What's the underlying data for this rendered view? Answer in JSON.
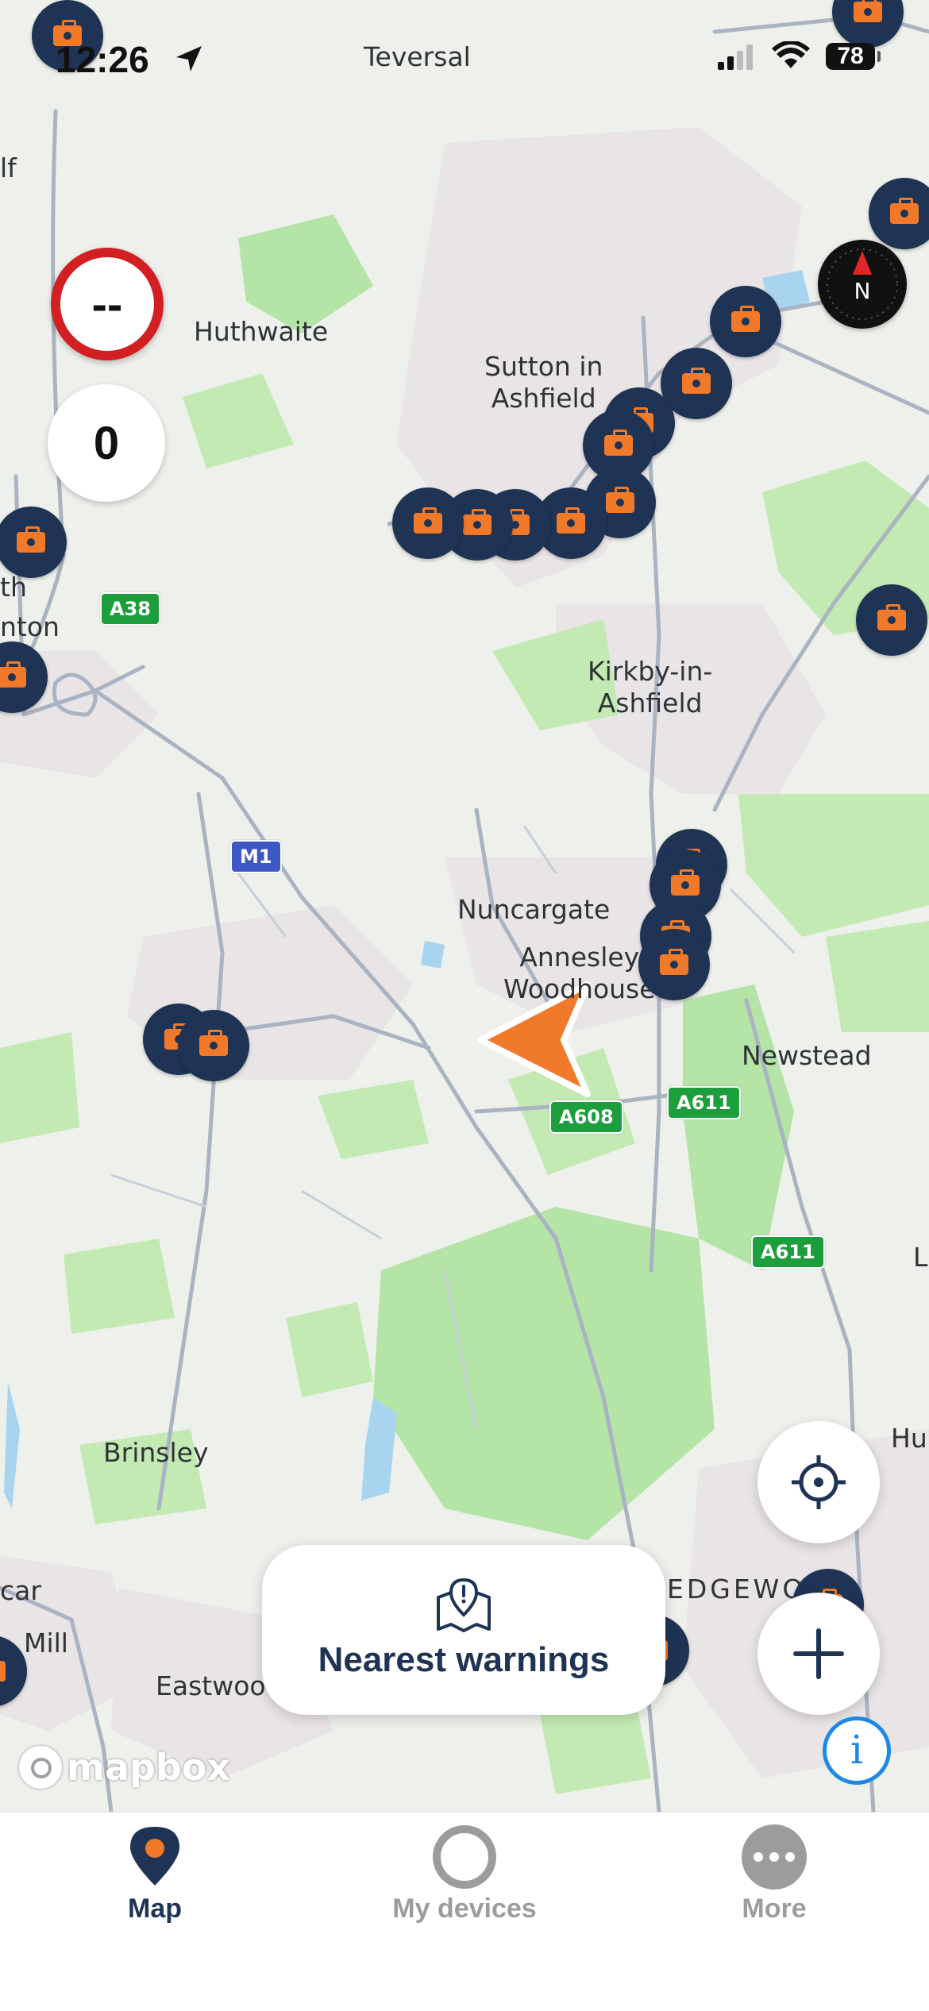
{
  "status_bar": {
    "time": "12:26",
    "battery": "78"
  },
  "map": {
    "places": [
      "Teversal",
      "Huthwaite",
      "Sutton in\nAshfield",
      "Kirkby-in-\nAshfield",
      "Nuncargate",
      "Annesley\nWoodhouse",
      "Newstead",
      "Brinsley",
      "Eastwood",
      "EDGEWO",
      "Hu",
      "lf",
      "th",
      "nton",
      "car",
      "Mill",
      "L"
    ],
    "roads": [
      "A38",
      "M1",
      "A608",
      "A611",
      "A611"
    ]
  },
  "speed_limit": {
    "value": "--"
  },
  "current_speed": {
    "value": "0"
  },
  "compass": {
    "label": "N"
  },
  "nearest_warnings": {
    "label": "Nearest warnings"
  },
  "attribution": {
    "label": "mapbox"
  },
  "info_button": {
    "label": "i"
  },
  "tabs": [
    {
      "label": "Map",
      "active": true
    },
    {
      "label": "My devices",
      "active": false
    },
    {
      "label": "More",
      "active": false
    }
  ],
  "colors": {
    "navy": "#1f3454",
    "accent": "#f07a2a",
    "speed_red": "#d21f22",
    "info_blue": "#1e88e5"
  }
}
